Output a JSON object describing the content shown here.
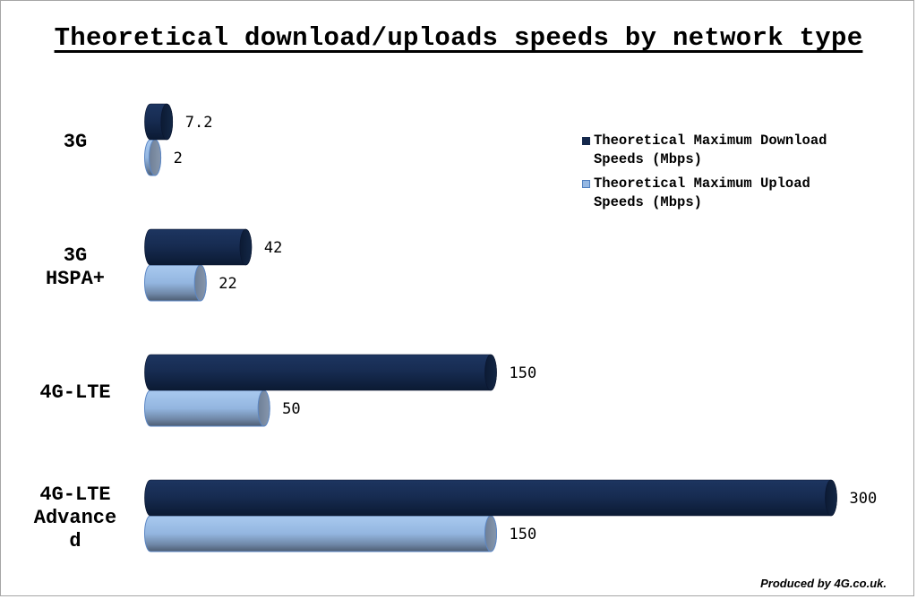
{
  "chart_data": {
    "type": "bar",
    "orientation": "horizontal",
    "style": "3d-cylinder",
    "title": "Theoretical download/uploads speeds by network type",
    "xlabel": "",
    "ylabel": "",
    "grid": false,
    "axes_visible": false,
    "xlim": [
      0,
      300
    ],
    "categories": [
      "3G",
      "3G HSPA+",
      "4G-LTE",
      "4G-LTE Advanced"
    ],
    "category_label_lines": [
      [
        "3G"
      ],
      [
        "3G",
        "HSPA+"
      ],
      [
        "4G-LTE"
      ],
      [
        "4G-LTE",
        "Advance",
        "d"
      ]
    ],
    "series": [
      {
        "name": "Theoretical Maximum Download Speeds (Mbps)",
        "color": "#14284b",
        "values": [
          7.2,
          42,
          150,
          300
        ],
        "labels": [
          "7.2",
          "42",
          "150",
          "300"
        ]
      },
      {
        "name": "Theoretical Maximum Upload Speeds (Mbps)",
        "color": "#95b8e3",
        "values": [
          2,
          22,
          50,
          150
        ],
        "labels": [
          "2",
          "22",
          "50",
          "150"
        ]
      }
    ],
    "legend": {
      "position": "right",
      "items": [
        {
          "line1": "Theoretical Maximum Download",
          "line2": "Speeds (Mbps)",
          "color": "#14284b"
        },
        {
          "line1": "Theoretical Maximum Upload",
          "line2": "Speeds (Mbps)",
          "color": "#95b8e3"
        }
      ]
    },
    "footer": "Produced by 4G.co.uk."
  }
}
